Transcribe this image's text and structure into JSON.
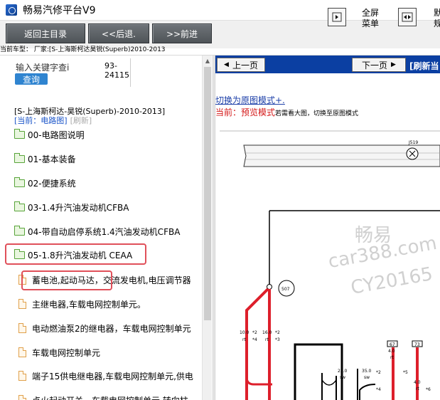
{
  "window": {
    "title": "畅易汽修平台V9"
  },
  "toolbar": {
    "back_main": "返回主目录",
    "back": "<<后退.",
    "forward": ">>前进",
    "fullscreen_label": "全屏\n菜单",
    "dual_label": "默\n规"
  },
  "vehicle_line": "当前车型： 厂家:[S-上海斯柯达昊锐(Superb)2010-2013",
  "search": {
    "placeholder": "输入关键字查i",
    "button": "查询",
    "result_line1": "93-",
    "result_line2": "24115"
  },
  "tree": {
    "vehicle": "[S-上海斯柯达-昊锐(Superb)-2010-2013]",
    "current": "[当前：电路图]",
    "refresh": "[刷新]",
    "folders": [
      "00-电路图说明",
      "01-基本装备",
      "02-便捷系统",
      "03-1.4升汽油发动机CFBA",
      "04-带自动启停系统1.4汽油发动机CFBA",
      "05-1.8升汽油发动机 CEAA"
    ],
    "docs": [
      "蓄电池,起动马达，交流发电机,电压调节器",
      "主继电器,车载电网控制单元。",
      "电动燃油泵2的继电器，车载电网控制单元",
      "车载电网控制单元",
      "端子15供电继电器,车载电网控制单元,供电",
      "点火起动开关，车载电网控制单元,转向柱"
    ]
  },
  "viewer": {
    "prev": "上一页",
    "next": "下一页",
    "refresh": "[刷新当",
    "mode_link": "切换为原图模式+.",
    "mode_prefix": "当前：",
    "mode_name": "预览模式",
    "mode_tip": "若需看大图，切换至原图模式"
  },
  "diagram": {
    "labels": {
      "j519": "J519",
      "ref507": "507",
      "w1_size": "10.0",
      "w1_color": "rt",
      "w1_pin": "*2",
      "w1_pin2": "*4",
      "w2_size": "16.0",
      "w2_color": "rt",
      "w2_pin": "*2",
      "w2_pin2": "*3",
      "w3_size": "25.0",
      "w3_color": "sw",
      "w4_size": "35.0",
      "w4_color": "sw",
      "pin_a": "*2",
      "pin_b": "*4",
      "pin_c": "*5",
      "pin_d": "*6",
      "box67": "67",
      "box73": "73",
      "w5_size": "4.0",
      "w5_color": "rt",
      "w6_size": "4.0",
      "w6_color": "rt"
    },
    "watermark": [
      "畅易",
      "car388.com",
      "CY20165"
    ]
  }
}
